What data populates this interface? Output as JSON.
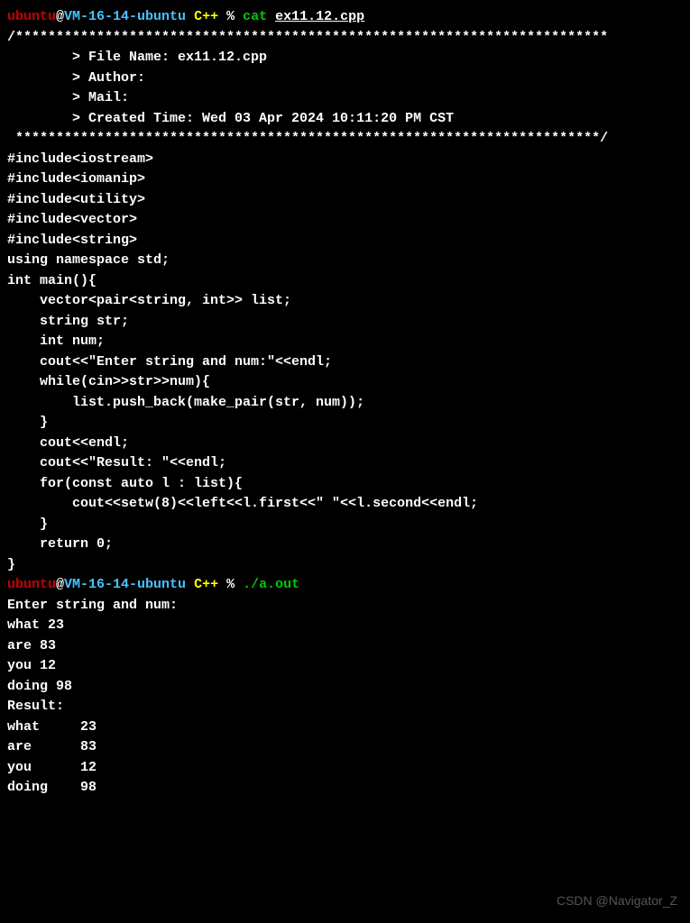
{
  "prompt1": {
    "user": "ubuntu",
    "at": "@",
    "host": "VM-16-14-ubuntu",
    "dir": "C++",
    "pct": "%",
    "cmd": "cat",
    "arg": "ex11.12.cpp"
  },
  "code": {
    "stars_open": "/*************************************************************************",
    "l_file": "        > File Name: ex11.12.cpp",
    "l_author": "        > Author:",
    "l_mail": "        > Mail:",
    "l_created": "        > Created Time: Wed 03 Apr 2024 10:11:20 PM CST",
    "stars_close": " ************************************************************************/",
    "blank": "",
    "inc1": "#include<iostream>",
    "inc2": "#include<iomanip>",
    "inc3": "#include<utility>",
    "inc4": "#include<vector>",
    "inc5": "#include<string>",
    "usens": "using namespace std;",
    "main_open": "int main(){",
    "b1": "    vector<pair<string, int>> list;",
    "b2": "    string str;",
    "b3": "    int num;",
    "b4": "    cout<<\"Enter string and num:\"<<endl;",
    "b5": "    while(cin>>str>>num){",
    "b6": "        list.push_back(make_pair(str, num));",
    "b7": "    }",
    "b8": "    cout<<endl;",
    "b9": "    cout<<\"Result: \"<<endl;",
    "b10": "    for(const auto l : list){",
    "b11": "        cout<<setw(8)<<left<<l.first<<\" \"<<l.second<<endl;",
    "b12": "    }",
    "ret": "    return 0;",
    "main_close": "}"
  },
  "prompt2": {
    "user": "ubuntu",
    "at": "@",
    "host": "VM-16-14-ubuntu",
    "dir": "C++",
    "pct": "%",
    "exec": "./a.out"
  },
  "out": {
    "l1": "Enter string and num:",
    "l2": "what 23",
    "l3": "are 83",
    "l4": "you 12",
    "l5": "doing 98",
    "blank": "",
    "r0": "Result:",
    "r1": "what     23",
    "r2": "are      83",
    "r3": "you      12",
    "r4": "doing    98"
  },
  "watermark": "CSDN @Navigator_Z"
}
